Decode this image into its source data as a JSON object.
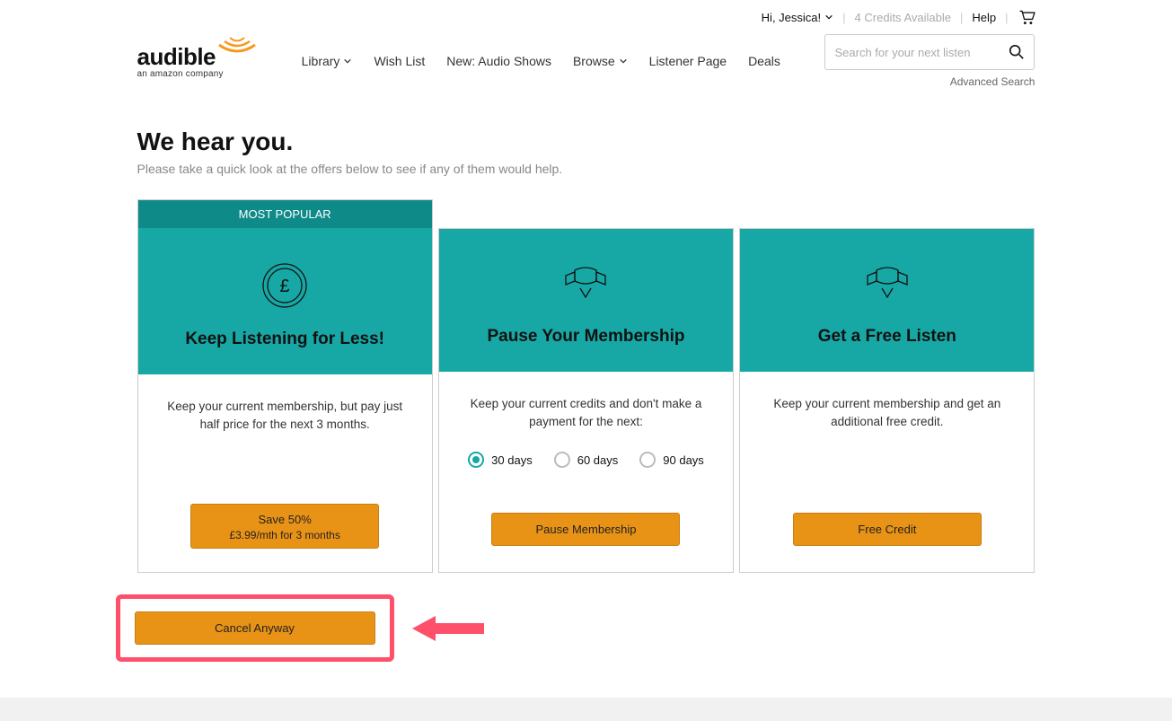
{
  "topbar": {
    "greeting": "Hi, Jessica!",
    "credits": "4 Credits Available",
    "help": "Help"
  },
  "nav": {
    "library": "Library",
    "wish": "Wish List",
    "new": "New: Audio Shows",
    "browse": "Browse",
    "listener": "Listener Page",
    "deals": "Deals"
  },
  "search": {
    "placeholder": "Search for your next listen",
    "advanced": "Advanced Search"
  },
  "brand": {
    "name": "audible",
    "tagline": "an amazon company"
  },
  "headline": {
    "title": "We hear you.",
    "subtitle": "Please take a quick look at the offers below to see if any of them would help."
  },
  "cards": {
    "badge": "MOST POPULAR",
    "c1": {
      "title": "Keep Listening for Less!",
      "desc": "Keep your current membership, but pay just half price for the next 3 months.",
      "btn1": "Save 50%",
      "btn2": "£3.99/mth for 3 months"
    },
    "c2": {
      "title": "Pause Your Membership",
      "desc": "Keep your current credits and don't make a payment for the next:",
      "opt1": "30 days",
      "opt2": "60 days",
      "opt3": "90 days",
      "btn": "Pause Membership"
    },
    "c3": {
      "title": "Get a Free Listen",
      "desc": "Keep your current membership and get an additional free credit.",
      "btn": "Free Credit"
    }
  },
  "cancel": {
    "label": "Cancel Anyway"
  }
}
